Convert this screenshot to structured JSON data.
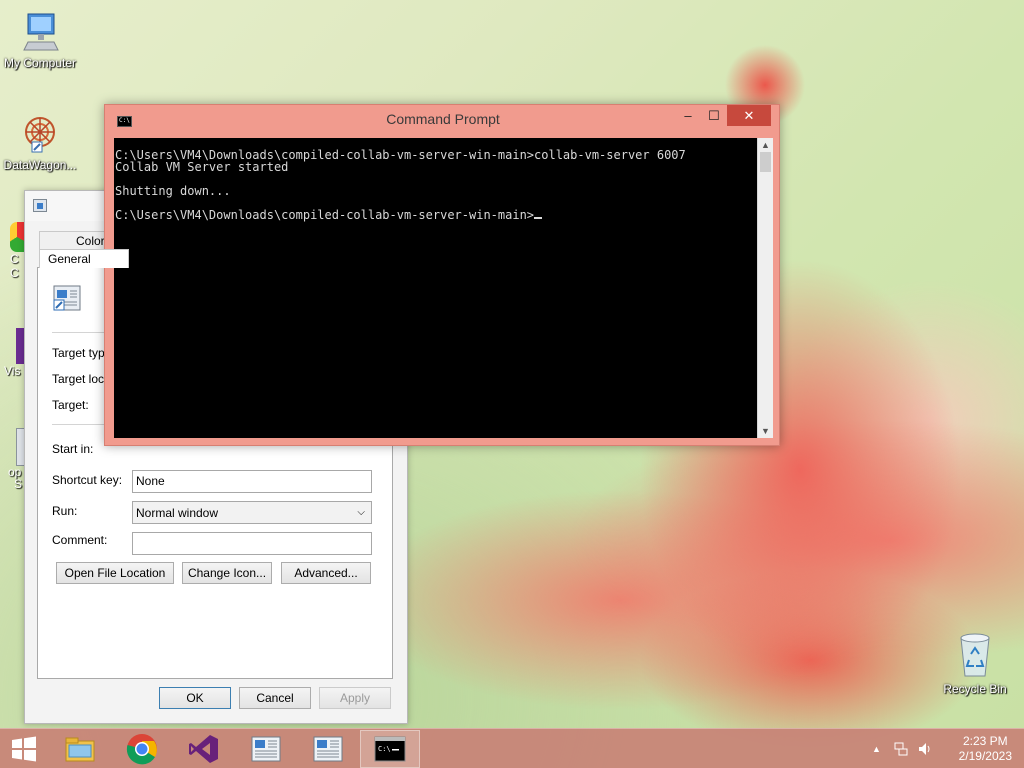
{
  "desktop": {
    "icons": [
      {
        "label": "My Computer",
        "icon": "computer-icon"
      },
      {
        "label": "DataWagon...",
        "icon": "datawagon-icon"
      },
      {
        "label": "Recycle Bin",
        "icon": "recycle-bin-icon"
      }
    ],
    "partial_icon_letters": [
      "C",
      "C",
      "Vis",
      "op",
      "S"
    ]
  },
  "properties_dialog": {
    "tabs": [
      "Colors",
      "General"
    ],
    "fields": {
      "target_type_label": "Target type",
      "target_location_label": "Target loca",
      "target_label": "Target:",
      "start_in_label": "Start in:",
      "shortcut_key_label": "Shortcut key:",
      "shortcut_key_value": "None",
      "run_label": "Run:",
      "run_value": "Normal window",
      "comment_label": "Comment:",
      "comment_value": ""
    },
    "buttons": {
      "open_file_location": "Open File Location",
      "change_icon": "Change Icon...",
      "advanced": "Advanced...",
      "ok": "OK",
      "cancel": "Cancel",
      "apply": "Apply"
    }
  },
  "command_prompt": {
    "title": "Command Prompt",
    "controls": {
      "minimize": "–",
      "maximize": "☐",
      "close": "✕"
    },
    "lines": [
      "C:\\Users\\VM4\\Downloads\\compiled-collab-vm-server-win-main>collab-vm-server 6007",
      "Collab VM Server started",
      "",
      "Shutting down...",
      "",
      "C:\\Users\\VM4\\Downloads\\compiled-collab-vm-server-win-main>"
    ]
  },
  "taskbar": {
    "buttons": [
      "start-button",
      "file-explorer",
      "chrome",
      "visual-studio",
      "properties-window-1",
      "properties-window-2",
      "command-prompt"
    ],
    "clock": {
      "time": "2:23 PM",
      "date": "2/19/2023"
    }
  },
  "colors": {
    "window_accent": "#f19b8e",
    "close_button": "#c7493d",
    "taskbar": "#c88276",
    "console_bg": "#000000",
    "console_text": "#d9d9d9"
  }
}
